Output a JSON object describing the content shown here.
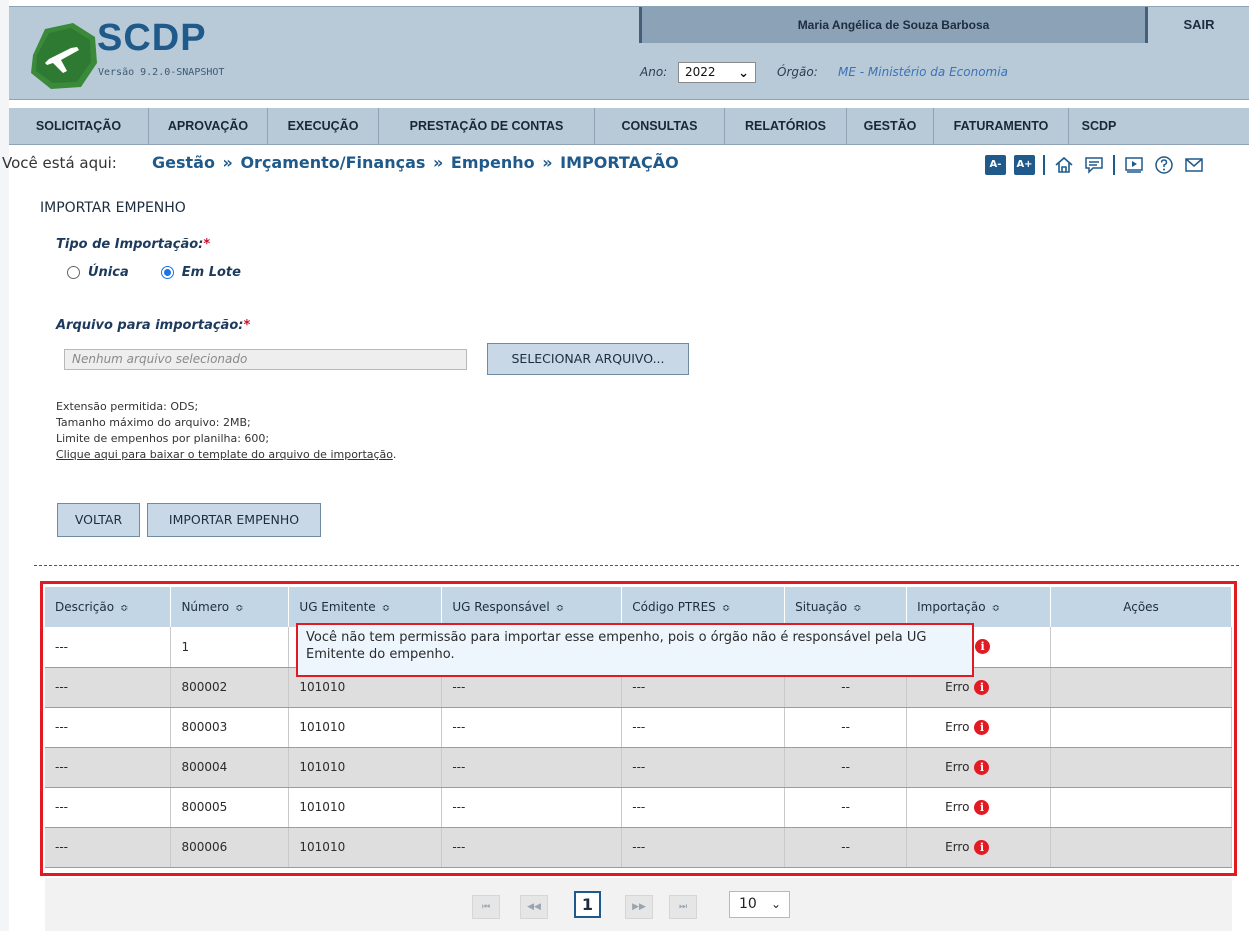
{
  "header": {
    "logo_text": "SCDP",
    "version": "Versão 9.2.0-SNAPSHOT",
    "user_name": "Maria Angélica de Souza Barbosa",
    "logout_label": "SAIR",
    "ano_label": "Ano:",
    "ano_value": "2022",
    "orgao_label": "Órgão:",
    "orgao_value": "ME - Ministério da Economia"
  },
  "menu": {
    "items": [
      {
        "label": "SOLICITAÇÃO"
      },
      {
        "label": "APROVAÇÃO"
      },
      {
        "label": "EXECUÇÃO"
      },
      {
        "label": "PRESTAÇÃO DE CONTAS"
      },
      {
        "label": "CONSULTAS"
      },
      {
        "label": "RELATÓRIOS"
      },
      {
        "label": "GESTÃO"
      },
      {
        "label": "FATURAMENTO"
      },
      {
        "label": "SCDP"
      }
    ]
  },
  "breadcrumb": {
    "prefix": "Você está aqui:",
    "items": [
      "Gestão",
      "Orçamento/Finanças",
      "Empenho",
      "IMPORTAÇÃO"
    ],
    "sep": "»"
  },
  "toolbar": {
    "font_decrease": "A-",
    "font_increase": "A+",
    "icons": [
      "home-icon",
      "chat-icon",
      "video-icon",
      "help-icon",
      "mail-icon"
    ]
  },
  "form": {
    "section_title": "IMPORTAR EMPENHO",
    "tipo_label": "Tipo de Importação:",
    "required_mark": "*",
    "radio_unica": "Única",
    "radio_lote": "Em Lote",
    "selected_radio": "Em Lote",
    "arquivo_label": "Arquivo para importação:",
    "file_placeholder": "Nenhum arquivo selecionado",
    "select_file_button": "SELECIONAR ARQUIVO...",
    "info_ext": "Extensão permitida: ODS;",
    "info_size": "Tamanho máximo do arquivo: 2MB;",
    "info_limit": "Limite de empenhos por planilha: 600;",
    "template_link": "Clique aqui para baixar o template do arquivo de importação",
    "template_link_suffix": ".",
    "back_button": "VOLTAR",
    "import_button": "IMPORTAR EMPENHO"
  },
  "table": {
    "sort_glyph": "≎",
    "headers": [
      "Descrição",
      "Número",
      "UG Emitente",
      "UG Responsável",
      "Código PTRES",
      "Situação",
      "Importação",
      "Ações"
    ],
    "rows": [
      {
        "descricao": "---",
        "numero": "1",
        "ug_emitente": "",
        "ug_responsavel": "",
        "ptres": "",
        "situacao": "",
        "importacao": ""
      },
      {
        "descricao": "---",
        "numero": "800002",
        "ug_emitente": "101010",
        "ug_responsavel": "---",
        "ptres": "---",
        "situacao": "--",
        "importacao": "Erro"
      },
      {
        "descricao": "---",
        "numero": "800003",
        "ug_emitente": "101010",
        "ug_responsavel": "---",
        "ptres": "---",
        "situacao": "--",
        "importacao": "Erro"
      },
      {
        "descricao": "---",
        "numero": "800004",
        "ug_emitente": "101010",
        "ug_responsavel": "---",
        "ptres": "---",
        "situacao": "--",
        "importacao": "Erro"
      },
      {
        "descricao": "---",
        "numero": "800005",
        "ug_emitente": "101010",
        "ug_responsavel": "---",
        "ptres": "---",
        "situacao": "--",
        "importacao": "Erro"
      },
      {
        "descricao": "---",
        "numero": "800006",
        "ug_emitente": "101010",
        "ug_responsavel": "---",
        "ptres": "---",
        "situacao": "--",
        "importacao": "Erro"
      }
    ],
    "tooltip": "Você não tem permissão para importar esse empenho, pois o órgão não é responsável pela UG Emitente do empenho."
  },
  "pagination": {
    "first": "⏮",
    "prev": "◀◀",
    "current_page": "1",
    "next": "▶▶",
    "last": "⏭",
    "page_size": "10"
  },
  "colors": {
    "brand": "#1f5a8a",
    "header_bg": "#b8cad8",
    "error_red": "#e01b24",
    "radio_blue": "#1a73e8"
  }
}
